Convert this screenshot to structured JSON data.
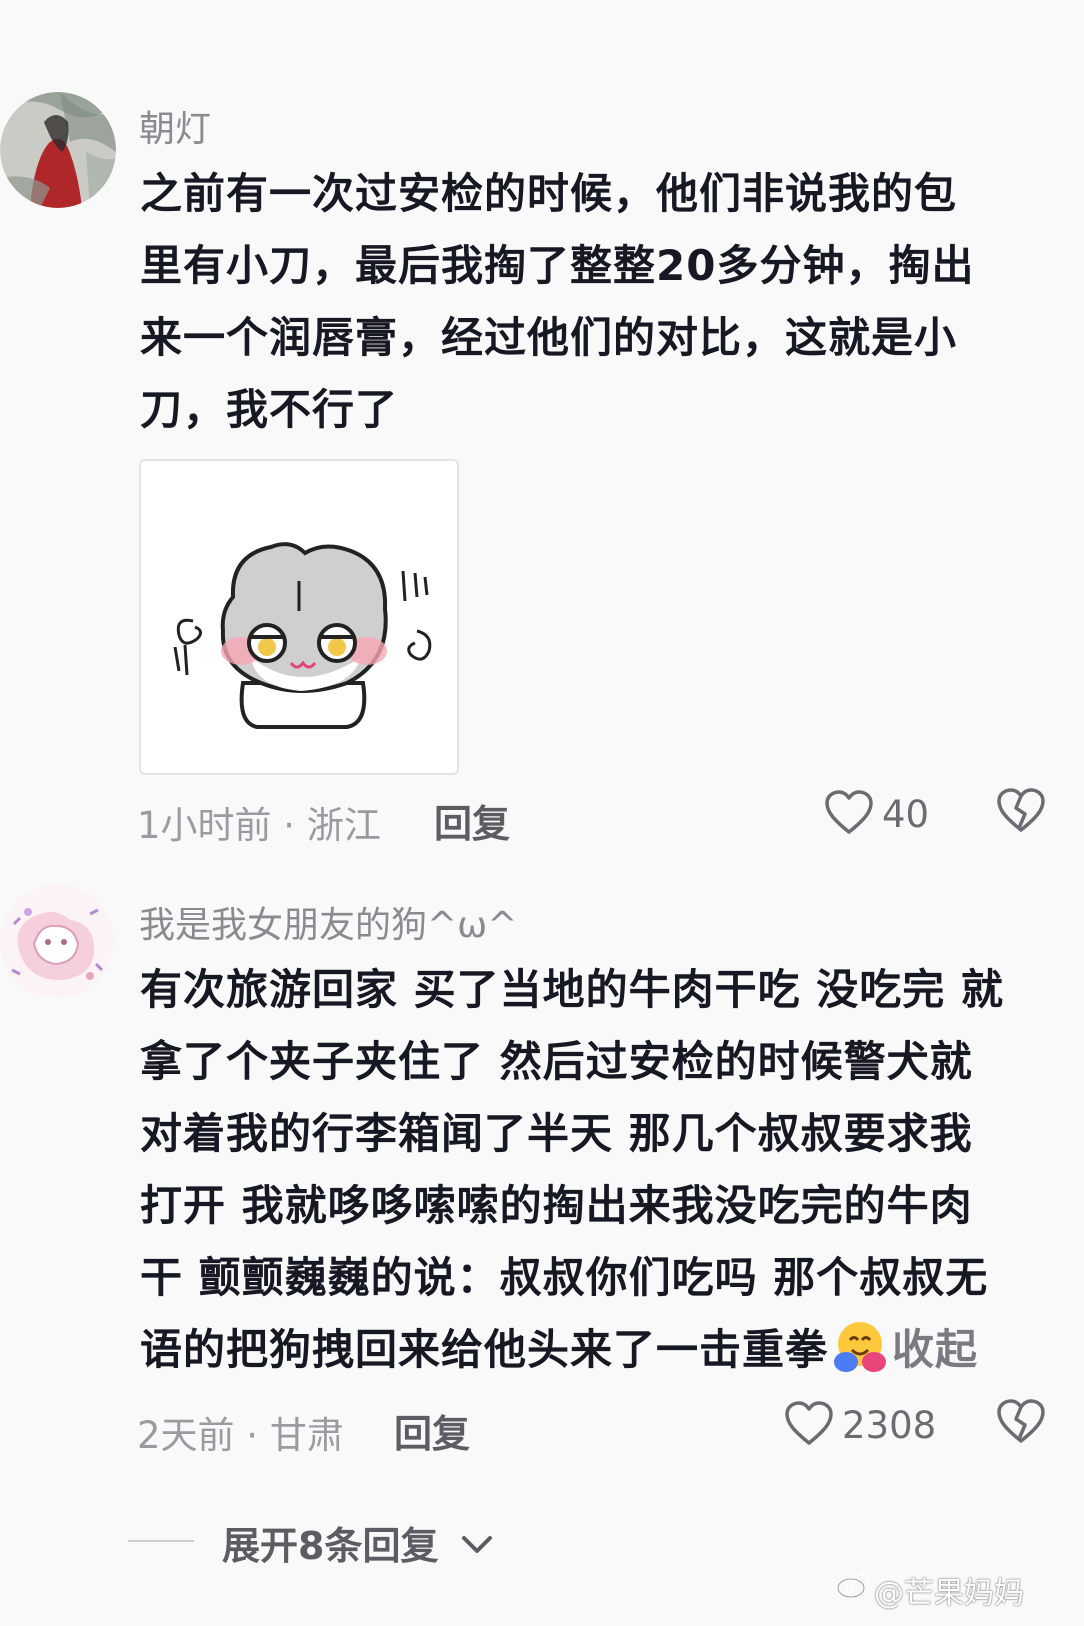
{
  "comments": [
    {
      "username": "朝灯",
      "content_lines": [
        "之前有一次过安检的时候，他们非说我的包",
        "里有小刀，最后我掏了整整20多分钟，掏出",
        "来一个润唇膏，经过他们的对比，这就是小",
        "刀，我不行了"
      ],
      "meta": "1小时前 · 浙江",
      "reply_label": "回复",
      "likes": "40"
    },
    {
      "username": "我是我女朋友的狗^ω^",
      "content_lines": [
        "有次旅游回家 买了当地的牛肉干吃 没吃完 就",
        "拿了个夹子夹住了 然后过安检的时候警犬就",
        "对着我的行李箱闻了半天 那几个叔叔要求我",
        "打开 我就哆哆嗦嗦的掏出来我没吃完的牛肉",
        "干 颤颤巍巍的说：叔叔你们吃吗 那个叔叔无",
        "语的把狗拽回来给他头来了一击重拳"
      ],
      "collapse_label": "收起",
      "meta": "2天前 · 甘肃",
      "reply_label": "回复",
      "likes": "2308"
    }
  ],
  "expand_replies_label": "展开8条回复",
  "watermark": "@芒果妈妈",
  "icons": {
    "like": "heart-outline-icon",
    "dislike": "broken-heart-icon",
    "expand": "chevron-down-icon",
    "weibo": "weibo-logo-icon",
    "emoji": "hugging-face-emoji"
  }
}
